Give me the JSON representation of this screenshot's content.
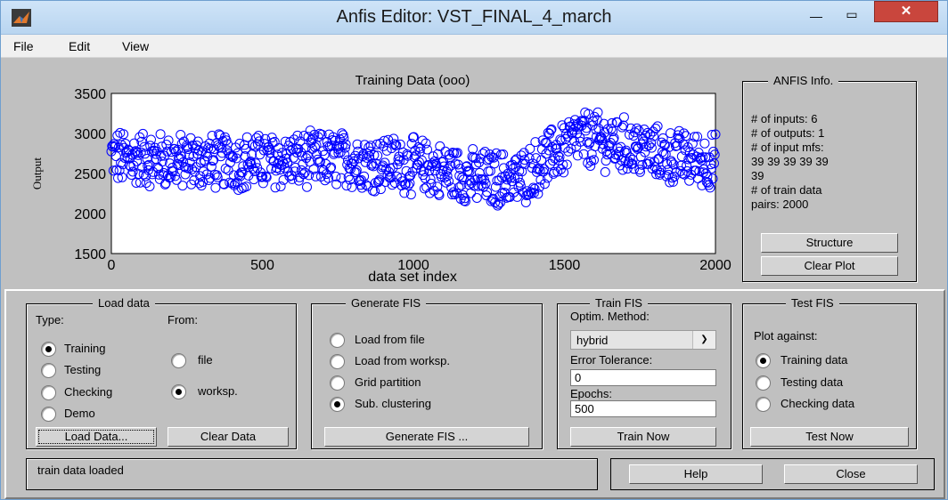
{
  "window": {
    "title": "Anfis Editor: VST_FINAL_4_march",
    "minimize_glyph": "—",
    "maximize_glyph": "▭",
    "close_glyph": "✕"
  },
  "menu": [
    "File",
    "Edit",
    "View"
  ],
  "plot": {
    "title": "Training Data (ooo)",
    "xlabel": "data set index",
    "ylabel": "Output",
    "marker_color": "#0000ff"
  },
  "chart_data": {
    "type": "scatter",
    "title": "Training Data (ooo)",
    "xlabel": "data set index",
    "ylabel": "Output",
    "xlim": [
      0,
      2000
    ],
    "ylim": [
      1500,
      3500
    ],
    "x_ticks": [
      "0",
      "500",
      "1000",
      "1500",
      "2000"
    ],
    "y_ticks": [
      "1500",
      "2000",
      "2500",
      "3000",
      "3500"
    ],
    "marker": "o",
    "n_points": 2000,
    "trend": [
      {
        "x": 0,
        "y": 2700
      },
      {
        "x": 250,
        "y": 2650
      },
      {
        "x": 500,
        "y": 2650
      },
      {
        "x": 750,
        "y": 2680
      },
      {
        "x": 1000,
        "y": 2600
      },
      {
        "x": 1200,
        "y": 2450
      },
      {
        "x": 1350,
        "y": 2420
      },
      {
        "x": 1450,
        "y": 2700
      },
      {
        "x": 1550,
        "y": 2950
      },
      {
        "x": 1700,
        "y": 2850
      },
      {
        "x": 1850,
        "y": 2700
      },
      {
        "x": 2000,
        "y": 2650
      }
    ],
    "spread": 320
  },
  "info": {
    "title": "ANFIS Info.",
    "lines": [
      "# of inputs: 6",
      "# of outputs: 1",
      "# of input mfs:",
      "39  39  39  39  39",
      "39",
      "# of train data",
      "pairs: 2000"
    ],
    "structure_button": "Structure",
    "clear_plot_button": "Clear Plot"
  },
  "load_data": {
    "title": "Load data",
    "type_label": "Type:",
    "from_label": "From:",
    "types": [
      "Training",
      "Testing",
      "Checking",
      "Demo"
    ],
    "selected_type": "Training",
    "sources": [
      "file",
      "worksp."
    ],
    "selected_source": "worksp.",
    "load_button": "Load Data...",
    "clear_button": "Clear Data"
  },
  "generate_fis": {
    "title": "Generate FIS",
    "options": [
      "Load from file",
      "Load from worksp.",
      "Grid partition",
      "Sub. clustering"
    ],
    "selected": "Sub. clustering",
    "button": "Generate FIS ..."
  },
  "train_fis": {
    "title": "Train FIS",
    "method_label": "Optim. Method:",
    "method_value": "hybrid",
    "tolerance_label": "Error Tolerance:",
    "tolerance_value": "0",
    "epochs_label": "Epochs:",
    "epochs_value": "500",
    "button": "Train Now"
  },
  "test_fis": {
    "title": "Test FIS",
    "plot_against_label": "Plot against:",
    "options": [
      "Training data",
      "Testing data",
      "Checking data"
    ],
    "selected": "Training data",
    "button": "Test Now"
  },
  "status": "train data loaded",
  "help_button": "Help",
  "close_button": "Close"
}
